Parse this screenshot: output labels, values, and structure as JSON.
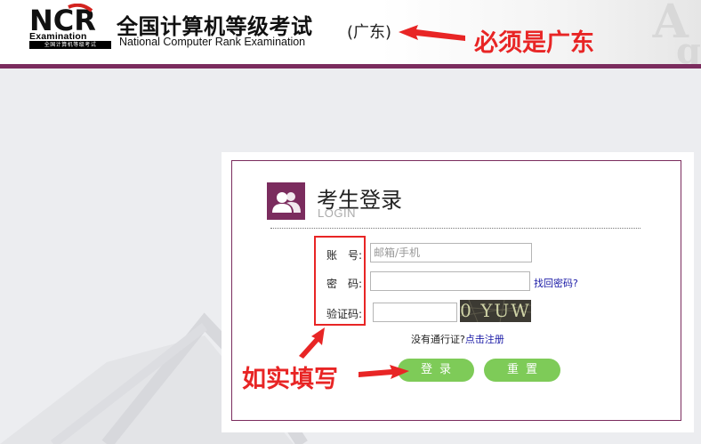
{
  "header": {
    "logo_letters": "NCR",
    "logo_sub": "Examination",
    "logo_strip": "全国计算机等级考试",
    "title_cn": "全国计算机等级考试",
    "title_en": "National Computer Rank Examination",
    "region": "(广东)"
  },
  "annotations": {
    "region_note": "必须是广东",
    "fill_note": "如实填写"
  },
  "login": {
    "title": "考生登录",
    "subtitle": "LOGIN",
    "account_label": "账　号:",
    "account_placeholder": "邮箱/手机",
    "password_label": "密　码:",
    "captcha_label": "验证码:",
    "captcha_code": "0 YUW",
    "forgot_link": "找回密码?",
    "register_prefix": "没有通行证?",
    "register_link": "点击注册",
    "login_button": "登录",
    "reset_button": "重置"
  },
  "colors": {
    "brand": "#7b2c5e",
    "button": "#7ecb58",
    "annotation": "#e82525",
    "link": "#1a1aa6"
  }
}
